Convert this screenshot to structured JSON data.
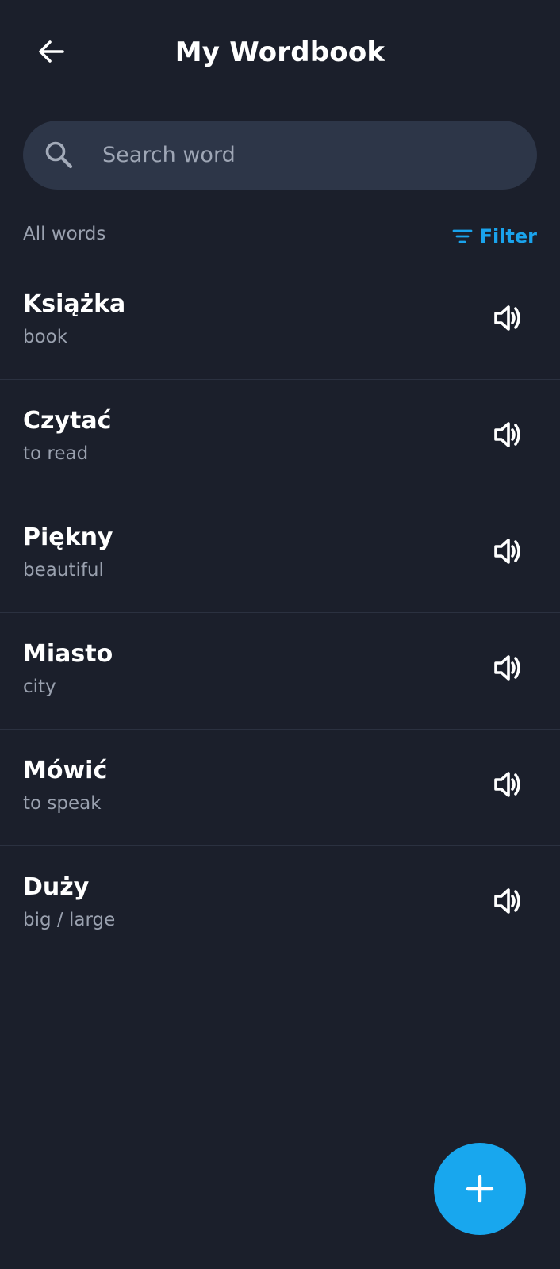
{
  "header": {
    "title": "My Wordbook",
    "back_icon": "arrow-left-icon"
  },
  "search": {
    "placeholder": "Search word",
    "value": "",
    "icon": "search-icon"
  },
  "list_header": {
    "section_label": "All words",
    "filter_label": "Filter",
    "filter_icon": "filter-icon"
  },
  "words": [
    {
      "term": "Książka",
      "meaning": "book"
    },
    {
      "term": "Czytać",
      "meaning": "to read"
    },
    {
      "term": "Piękny",
      "meaning": "beautiful"
    },
    {
      "term": "Miasto",
      "meaning": "city"
    },
    {
      "term": "Mówić",
      "meaning": "to speak"
    },
    {
      "term": "Duży",
      "meaning": "big / large"
    }
  ],
  "fab": {
    "icon": "plus-icon"
  },
  "colors": {
    "background": "#1b1f2b",
    "search_background": "#2d3648",
    "accent": "#18a7ee",
    "secondary_text": "#9aa1af"
  }
}
